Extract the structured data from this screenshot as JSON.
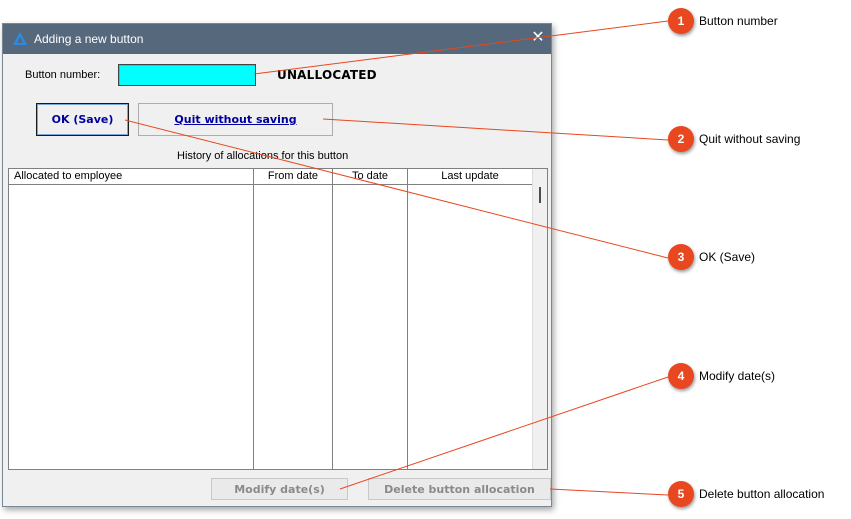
{
  "window": {
    "title": "Adding a new button",
    "close_icon": "close-icon",
    "app_icon": "blue-triangle-logo-icon"
  },
  "form": {
    "button_number_label": "Button number:",
    "button_number_value": "",
    "status": "UNALLOCATED",
    "ok_label": "OK (Save)",
    "quit_label": "Quit without saving",
    "history_label": "History of allocations for this button"
  },
  "table": {
    "columns": [
      "Allocated to employee",
      "From date",
      "To date",
      "Last update"
    ],
    "rows": []
  },
  "bottom": {
    "modify_label": "Modify date(s)",
    "delete_label": "Delete button allocation"
  },
  "callouts": [
    {
      "number": "1",
      "label": "Button number"
    },
    {
      "number": "2",
      "label": "Quit without saving"
    },
    {
      "number": "3",
      "label": "OK (Save)"
    },
    {
      "number": "4",
      "label": "Modify date(s)"
    },
    {
      "number": "5",
      "label": "Delete button allocation"
    }
  ],
  "colors": {
    "titlebar": "#55687c",
    "input_background": "#00ffff",
    "callout": "#e8471f",
    "button_text": "#0000a0"
  }
}
